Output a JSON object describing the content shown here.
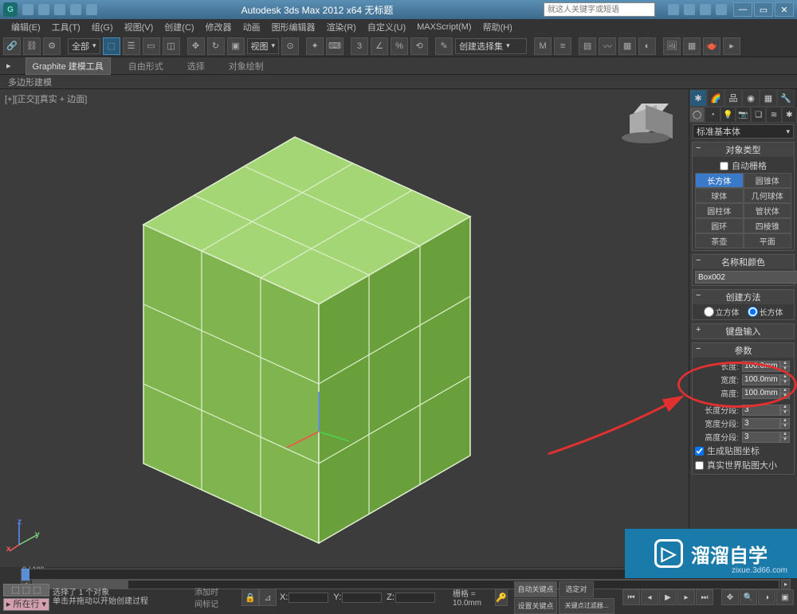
{
  "title": "Autodesk 3ds Max  2012  x64   无标题",
  "search_placeholder": "就这人关键字或短语",
  "menus": [
    "编辑(E)",
    "工具(T)",
    "组(G)",
    "视图(V)",
    "创建(C)",
    "修改器",
    "动画",
    "图形编辑器",
    "渲染(R)",
    "自定义(U)",
    "MAXScript(M)",
    "帮助(H)"
  ],
  "toolbar_all": "全部",
  "toolbar_view": "视图",
  "toolbar_select_set": "创建选择集",
  "ribbon": {
    "tabs": [
      "Graphite 建模工具",
      "自由形式",
      "选择",
      "对象绘制"
    ],
    "sub": "多边形建模"
  },
  "viewport_label": "[+][正交][真实 + 边面]",
  "panel": {
    "category": "标准基本体",
    "rollout_objtype": "对象类型",
    "autogrid": "自动栅格",
    "objects": [
      "长方体",
      "圆锥体",
      "球体",
      "几何球体",
      "圆柱体",
      "管状体",
      "圆环",
      "四棱锥",
      "茶壶",
      "平面"
    ],
    "rollout_namecolor": "名称和颜色",
    "object_name": "Box002",
    "rollout_create": "创建方法",
    "radio_cube": "立方体",
    "radio_box": "长方体",
    "rollout_keyboard": "键盘输入",
    "rollout_params": "参数",
    "length_lbl": "长度:",
    "width_lbl": "宽度:",
    "height_lbl": "高度:",
    "lseg_lbl": "长度分段:",
    "wseg_lbl": "宽度分段:",
    "hseg_lbl": "高度分段:",
    "length_val": "100.0mm",
    "width_val": "100.0mm",
    "height_val": "100.0mm",
    "lseg_val": "3",
    "wseg_val": "3",
    "hseg_val": "3",
    "gen_mapping": "生成贴图坐标",
    "real_world": "真实世界贴图大小"
  },
  "timeline": {
    "start": "0",
    "end": "100",
    "pos": "0 / 100"
  },
  "status": {
    "now_btn": "所在行",
    "selected": "选择了 1 个对象",
    "hint": "单击并拖动以开始创建过程",
    "add_time": "添加时间标记",
    "grid": "栅格 = 10.0mm",
    "x": "X:",
    "y": "Y:",
    "z": "Z:",
    "autokey": "自动关键点",
    "selkey": "选定对",
    "setkey": "设置关键点",
    "keyfilter": "关键点过滤器..."
  },
  "watermark": {
    "text": "溜溜自学",
    "sub": "zixue.3d66.com"
  }
}
